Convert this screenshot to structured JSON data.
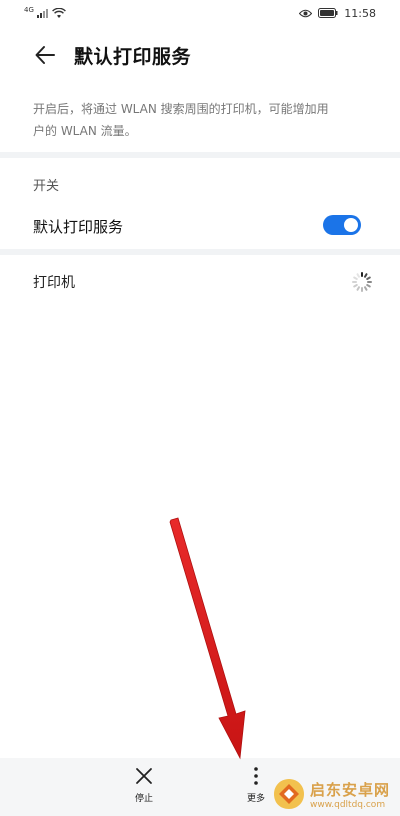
{
  "status_bar": {
    "signal_label": "4G",
    "time": "11:58"
  },
  "header": {
    "title": "默认打印服务"
  },
  "description": {
    "line1": "开启后，将通过 WLAN 搜索周围的打印机，可能增加用",
    "line2": "户的 WLAN 流量。"
  },
  "switch_section": {
    "label": "开关",
    "item_label": "默认打印服务",
    "enabled": true
  },
  "printer_section": {
    "label": "打印机"
  },
  "bottom_bar": {
    "stop_label": "停止",
    "more_label": "更多"
  },
  "watermark": {
    "title": "启东安卓网",
    "url": "www.qdltdq.com"
  },
  "colors": {
    "accent": "#1b74e8",
    "arrow": "#e01e1e",
    "divider": "#f1f3f5",
    "bottom_bar": "#f5f6f7"
  },
  "icons": [
    "wifi-icon",
    "eye-icon",
    "battery-icon",
    "back-arrow-icon",
    "loading-spinner-icon",
    "close-icon",
    "more-vertical-icon"
  ]
}
